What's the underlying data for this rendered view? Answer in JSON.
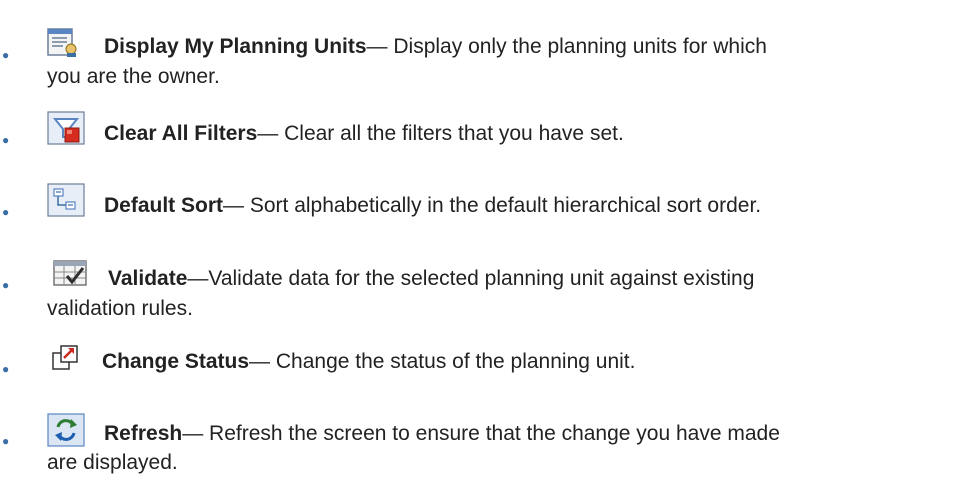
{
  "items": [
    {
      "icon": "display-planning-units-icon",
      "label": "Display My Planning Units",
      "sep": "—",
      "desc1": " Display only the planning units for which",
      "desc2": "you are the owner."
    },
    {
      "icon": "clear-filters-icon",
      "label": "Clear All Filters",
      "sep": "—",
      "desc1": " Clear all the filters that you have set."
    },
    {
      "icon": "default-sort-icon",
      "label": "Default Sort",
      "sep": "—",
      "desc1": " Sort alphabetically in the default hierarchical sort order."
    },
    {
      "icon": "validate-icon",
      "label": "Validate",
      "sep": "—",
      "desc1": "Validate data for the selected planning unit against existing",
      "desc2": "validation rules."
    },
    {
      "icon": "change-status-icon",
      "label": "Change Status",
      "sep": "—",
      "desc1": " Change the status of the planning unit."
    },
    {
      "icon": "refresh-icon",
      "label": "Refresh",
      "sep": "—",
      "desc1": " Refresh the screen to ensure that the change you have made",
      "desc2": "are displayed."
    }
  ]
}
